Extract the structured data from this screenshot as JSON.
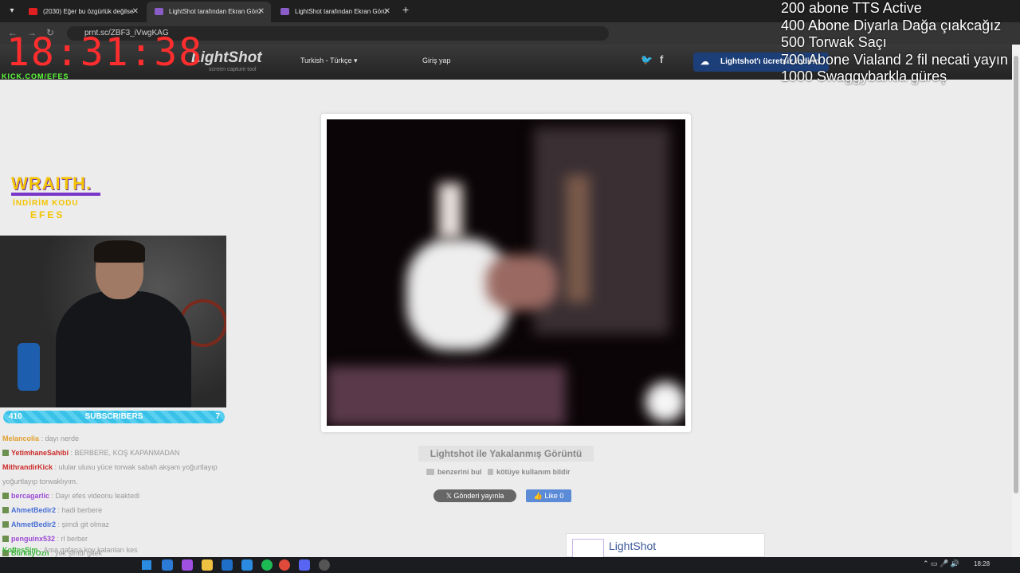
{
  "browser": {
    "tabs": [
      {
        "title": "(2030) Eğer bu özgürlük değilse",
        "favicon_color": "#e02020"
      },
      {
        "title": "LightShot tarafından Ekran Görü",
        "favicon_color": "#8a5cc8"
      },
      {
        "title": "LightShot tarafından Ekran Görü",
        "favicon_color": "#8a5cc8"
      }
    ],
    "url": "prnt.sc/ZBF3_iVwgKAG"
  },
  "overlay": {
    "clock": "18:31:38",
    "kick": "KICK.COM/EFES",
    "goals": [
      "200 abone TTS Active",
      "400 Abone Diyarla Dağa çıakcağız",
      "500 Torwak Saçı",
      "700 Abone Vialand 2 fil necati yayın",
      "1000 Swaggybarkla güreş"
    ],
    "sponsor_title": "WRAITH.",
    "sponsor_line1": "İNDİRİM KODU",
    "sponsor_line2": "EFES",
    "subs_count": "410",
    "subs_label": "SUBSCRIBERS",
    "subs_right": "7"
  },
  "lightshot": {
    "logo": "LightShot",
    "tagline": "screen capture tool",
    "language": "Turkish - Türkçe",
    "login": "Giriş yap",
    "cta": "Lightshot'ı ücretsiz indirin",
    "caption": "Lightshot ile Yakalanmış Görüntü",
    "find_similar": "benzerini bul",
    "report": "kötüye kullanım bildir",
    "tweet": "Gönderi yayınla",
    "like": "Like 0",
    "fb_name": "LightShot"
  },
  "chat": [
    {
      "user": "Melancolia",
      "color": "#e0a030",
      "text": ": dayı nerde"
    },
    {
      "user": "YetimhaneSahibi",
      "color": "#cc2b2b",
      "text": ": BERBERE, KOŞ KAPANMADAN"
    },
    {
      "user": "MithrandirKick",
      "color": "#cc2b2b",
      "text": ": ulular ulusu yüce torwak sabah akşam yoğurtlayıp"
    },
    {
      "user": "",
      "color": "#999",
      "text": "yoğurtlayıp torwaklıyım."
    },
    {
      "user": "bercagarlic",
      "color": "#9b4ad6",
      "text": ": Dayı efes videonu leaktedi"
    },
    {
      "user": "AhmetBedir2",
      "color": "#4a70d6",
      "text": ": hadi berbere"
    },
    {
      "user": "AhmetBedir2",
      "color": "#4a70d6",
      "text": ": şimdi git olmaz"
    },
    {
      "user": "penguinx532",
      "color": "#9b4ad6",
      "text": ": rl berber"
    },
    {
      "user": "BurkayOzn",
      "color": "#3ab53a",
      "text": ": yok şimdi gitek"
    },
    {
      "user": "KoftesSim",
      "color": "#3ab53a",
      "text": ": Ama gafana koy kalanları kes"
    }
  ],
  "taskbar": {
    "time": "18:28"
  }
}
